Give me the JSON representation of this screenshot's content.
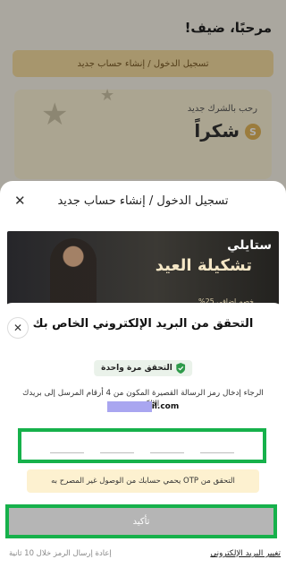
{
  "background": {
    "greeting": "مرحبًا، ضيف!",
    "login_button": "تسجيل الدخول / إنشاء حساب جديد",
    "card_subtitle": "رحب بالشرك جديد",
    "card_thanks": "شكراً",
    "card_symbol": "S"
  },
  "login_sheet": {
    "title": "تسجيل الدخول / إنشاء حساب جديد",
    "close_glyph": "✕",
    "banner_brand": "ستايلي",
    "banner_text": "تشكيلة العيد",
    "banner_sub": "خصم إضافي 25%"
  },
  "verify_sheet": {
    "title": "التحقق من البريد الإلكتروني الخاص بك",
    "close_glyph": "✕",
    "once_badge": "التحقق مرة واحدة",
    "instructions": "الرجاء إدخال رمز الرسالة القصيرة المكون من 4 أرقام المرسل إلى بريدك الإلكتروني",
    "email_suffix": "il.com",
    "otp_slots": [
      "",
      "",
      "",
      ""
    ],
    "otp_info": "التحقق من OTP يحمي حسابك من الوصول غير المصرح به",
    "confirm_button": "تأكيد",
    "change_email": "تغيير البريد الإلكتروني",
    "resend": "إعادة إرسال الرمز خلال 10 ثانية"
  },
  "colors": {
    "highlight": "#16b14b",
    "confirm_disabled": "#b5b5b5",
    "info_bg": "#fdf1d0",
    "badge_bg": "#eaf2ea"
  }
}
